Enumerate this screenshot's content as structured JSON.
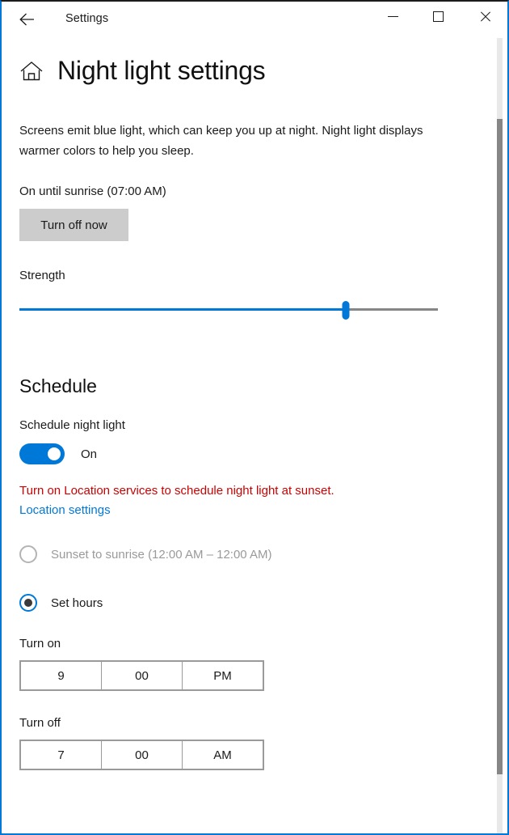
{
  "titlebar": {
    "back_icon": "back-arrow-icon",
    "app_title": "Settings",
    "minimize_icon": "minimize-icon",
    "maximize_icon": "maximize-icon",
    "close_icon": "close-icon"
  },
  "header": {
    "home_icon": "home-icon",
    "page_title": "Night light settings"
  },
  "main": {
    "description": "Screens emit blue light, which can keep you up at night. Night light displays warmer colors to help you sleep.",
    "status_text": "On until sunrise (07:00 AM)",
    "turn_off_now_label": "Turn off now",
    "strength": {
      "label": "Strength",
      "value_percent": 78
    }
  },
  "schedule": {
    "heading": "Schedule",
    "toggle_label": "Schedule night light",
    "toggle_state": "On",
    "warning_text": "Turn on Location services to schedule night light at sunset.",
    "location_settings_link": "Location settings",
    "options": [
      {
        "label": "Sunset to sunrise (12:00 AM – 12:00 AM)",
        "selected": false,
        "disabled": true
      },
      {
        "label": "Set hours",
        "selected": true,
        "disabled": false
      }
    ],
    "turn_on": {
      "label": "Turn on",
      "hour": "9",
      "minute": "00",
      "meridiem": "PM"
    },
    "turn_off": {
      "label": "Turn off",
      "hour": "7",
      "minute": "00",
      "meridiem": "AM"
    }
  },
  "colors": {
    "accent": "#0078d7",
    "warning": "#cc0000",
    "button_face": "#cccccc",
    "track_inactive": "#868686"
  }
}
